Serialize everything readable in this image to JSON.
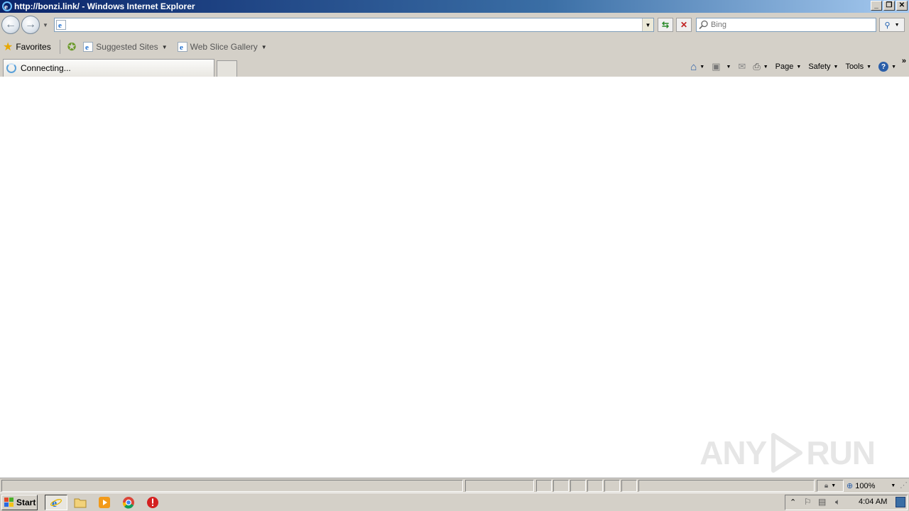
{
  "window": {
    "title": "http://bonzi.link/ - Windows Internet Explorer"
  },
  "navbar": {
    "address_value": "",
    "search_placeholder": "Bing"
  },
  "favorites": {
    "favorites_label": "Favorites",
    "items": [
      {
        "label": "Suggested Sites"
      },
      {
        "label": "Web Slice Gallery"
      }
    ]
  },
  "tabs": {
    "active_label": "Connecting..."
  },
  "commands": {
    "page": "Page",
    "safety": "Safety",
    "tools": "Tools"
  },
  "statusbar": {
    "zoom": "100%"
  },
  "watermark": {
    "left": "ANY",
    "right": "RUN"
  },
  "taskbar": {
    "start_label": "Start",
    "clock": "4:04 AM"
  },
  "colors": {
    "title_gradient_start": "#0a246a",
    "title_gradient_end": "#a6caf0",
    "chrome": "#d4d0c8",
    "content_bg": "#ffffff"
  },
  "icons": [
    "ie-icon",
    "back-icon",
    "forward-icon",
    "refresh-icon",
    "stop-icon",
    "search-icon",
    "star-icon",
    "add-favorites-icon",
    "home-icon",
    "feeds-icon",
    "mail-icon",
    "print-icon",
    "help-icon",
    "start-windows-icon",
    "explorer-folder-icon",
    "media-player-icon",
    "chrome-icon",
    "stop-sign-icon"
  ]
}
